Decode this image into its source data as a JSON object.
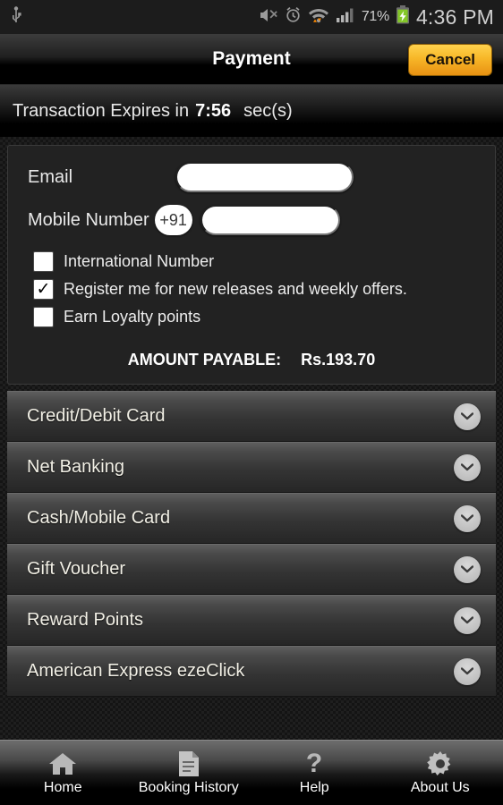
{
  "statusbar": {
    "icons": [
      "usb-icon",
      "mute-icon",
      "alarm-icon",
      "wifi-icon",
      "data-transfer-icon",
      "signal-icon"
    ],
    "battery_percent": "71%",
    "battery_state": "charging",
    "time": "4:36 PM"
  },
  "titlebar": {
    "title": "Payment",
    "cancel_label": "Cancel"
  },
  "expiry": {
    "prefix": "Transaction Expires in",
    "time": "7:56",
    "suffix": "sec(s)"
  },
  "form": {
    "email_label": "Email",
    "email_value": "",
    "mobile_label": "Mobile Number",
    "country_code": "+91",
    "mobile_value": "",
    "checkboxes": [
      {
        "label": "International Number",
        "checked": false,
        "mark": ""
      },
      {
        "label": "Register me for new releases and weekly offers.",
        "checked": true,
        "mark": "✓"
      },
      {
        "label": "Earn Loyalty points",
        "checked": false,
        "mark": ""
      }
    ],
    "amount_label": "AMOUNT PAYABLE:",
    "amount_value": "Rs.193.70"
  },
  "methods": [
    {
      "label": "Credit/Debit Card",
      "icon": "chevron-down-icon"
    },
    {
      "label": "Net Banking",
      "icon": "chevron-down-icon"
    },
    {
      "label": "Cash/Mobile Card",
      "icon": "chevron-down-icon"
    },
    {
      "label": "Gift Voucher",
      "icon": "chevron-down-icon"
    },
    {
      "label": "Reward Points",
      "icon": "chevron-down-icon"
    },
    {
      "label": "American Express ezeClick",
      "icon": "chevron-down-icon"
    }
  ],
  "navbar": [
    {
      "label": "Home",
      "icon": "home-icon"
    },
    {
      "label": "Booking History",
      "icon": "document-icon"
    },
    {
      "label": "Help",
      "icon": "question-mark-icon"
    },
    {
      "label": "About Us",
      "icon": "gear-icon"
    }
  ],
  "colors": {
    "accent": "#f7b728",
    "battery": "#84c728",
    "data_arrows": "#ff8a00",
    "panel_bg": "#222222"
  }
}
